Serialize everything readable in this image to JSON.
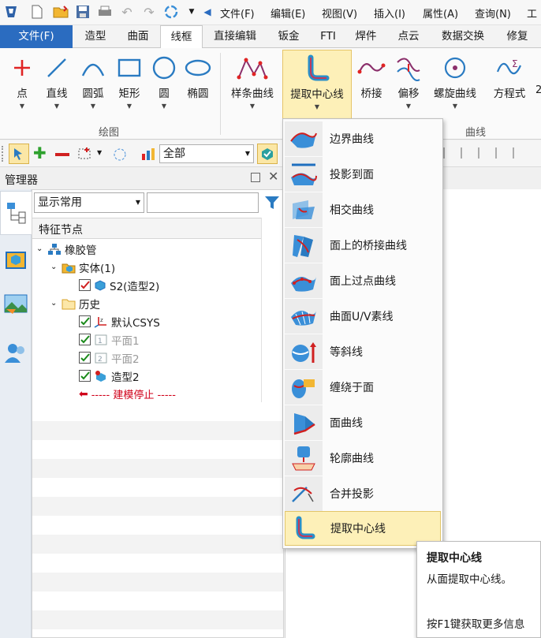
{
  "menubar": {
    "items": [
      "文件(F)",
      "编辑(E)",
      "视图(V)",
      "插入(I)",
      "属性(A)",
      "查询(N)",
      "工"
    ]
  },
  "tabs": [
    {
      "label": "文件(F)"
    },
    {
      "label": "造型"
    },
    {
      "label": "曲面"
    },
    {
      "label": "线框"
    },
    {
      "label": "直接编辑"
    },
    {
      "label": "钣金"
    },
    {
      "label": "FTI"
    },
    {
      "label": "焊件"
    },
    {
      "label": "点云"
    },
    {
      "label": "数据交换"
    },
    {
      "label": "修复"
    }
  ],
  "ribbon": {
    "draw": {
      "group_label": "绘图",
      "buttons": [
        "点",
        "直线",
        "圆弧",
        "矩形",
        "圆",
        "椭圆"
      ]
    },
    "curve": {
      "group_label": "曲线",
      "buttons": [
        "样条曲线",
        "提取中心线",
        "桥接",
        "偏移",
        "螺旋曲线",
        "方程式"
      ],
      "overflow_char": "2"
    }
  },
  "toolbar": {
    "filter_value": "全部"
  },
  "manager": {
    "title": "管理器",
    "display_select": "显示常用",
    "search_value": "",
    "column_header": "特征节点",
    "tree": {
      "root": "橡胶管",
      "solid_group": "实体(1)",
      "solid_item": "S2(造型2)",
      "history_group": "历史",
      "history_items": [
        "默认CSYS",
        "平面1",
        "平面2",
        "造型2"
      ],
      "stop_marker": "----- 建模停止 -----"
    }
  },
  "dropdown": {
    "items": [
      "边界曲线",
      "投影到面",
      "相交曲线",
      "面上的桥接曲线",
      "面上过点曲线",
      "曲面U/V素线",
      "等斜线",
      "缠绕于面",
      "面曲线",
      "轮廓曲线",
      "合并投影",
      "提取中心线"
    ]
  },
  "tooltip": {
    "title": "提取中心线",
    "description": "从面提取中心线。",
    "help": "按F1键获取更多信息"
  },
  "colors": {
    "accent_blue": "#2b6cc0",
    "highlight_yellow": "#fdf0b8",
    "stop_red": "#d0021b"
  }
}
